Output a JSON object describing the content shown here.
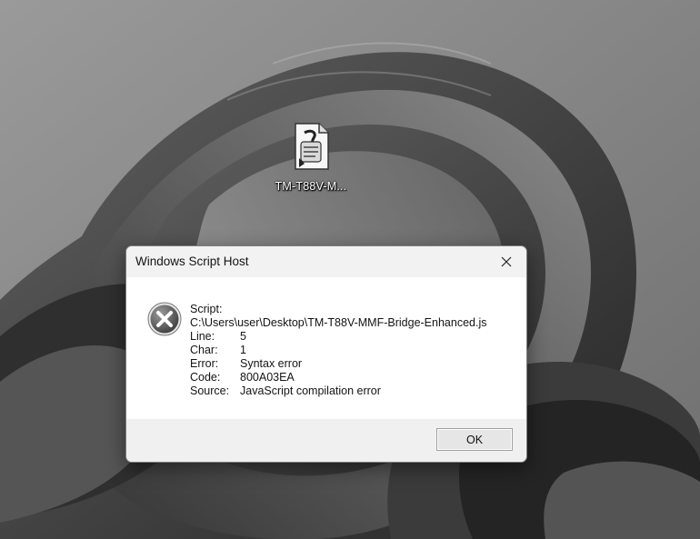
{
  "desktop": {
    "icon_label": "TM-T88V-M..."
  },
  "dialog": {
    "title": "Windows Script Host",
    "close_glyph": "✕",
    "details": {
      "script_label": "Script:",
      "script_path": "C:\\Users\\user\\Desktop\\TM-T88V-MMF-Bridge-Enhanced.js",
      "rows": [
        {
          "label": "Line:",
          "value": "5"
        },
        {
          "label": "Char:",
          "value": "1"
        },
        {
          "label": "Error:",
          "value": "Syntax error"
        },
        {
          "label": "Code:",
          "value": "800A03EA"
        },
        {
          "label": "Source:",
          "value": "JavaScript compilation error"
        }
      ]
    },
    "ok_label": "OK"
  },
  "icons": {
    "desktop_file": "script-file-icon",
    "dialog": "error-icon",
    "close": "close-icon"
  }
}
